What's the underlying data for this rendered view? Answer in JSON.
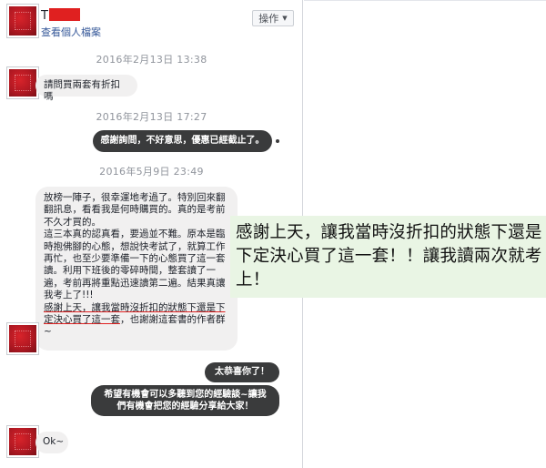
{
  "header": {
    "name": "T",
    "profile_link": "查看個人檔案",
    "action_button": "操作"
  },
  "timestamps": [
    "2016年2月13日 13:38",
    "2016年2月13日 17:27",
    "2016年5月9日 23:49"
  ],
  "messages": [
    {
      "from": "them",
      "text": "請問買兩套有折扣嗎"
    },
    {
      "from": "me",
      "text": "感謝詢問，不好意思，優惠已經截止了。"
    },
    {
      "from": "them",
      "text_main": "放榜一陣子，很幸運地考過了。特別回來翻翻訊息，看看我是何時購買的。真的是考前不久才買的。\n這三本真的認真看，要過並不難。原本是臨時抱佛腳的心態，想說快考試了，就算工作再忙，也至少要準備一下的心態買了這一套讀。利用下班後的零碎時間，整套讀了一遍，考前再將重點迅速讀第二遍。結果真讓我考上了!!!\n",
      "text_underlined": "感謝上天，讓我當時沒折扣的狀態下還是下定決心買了這一套",
      "text_end": "，也謝謝這套書的作者群~"
    },
    {
      "from": "me",
      "text": "太恭喜你了！"
    },
    {
      "from": "me",
      "text": "希望有機會可以多聽到您的經驗談~讓我們有機會把您的經驗分享給大家！"
    },
    {
      "from": "them",
      "text": "Ok~"
    }
  ],
  "callout": {
    "text": "感謝上天，讓我當時沒折扣的狀態下還是下定決心買了這一套！！讓我讀兩次就考上！",
    "background": "#e9f5e4"
  },
  "colors": {
    "outgoing_bubble": "#3a3b3c",
    "incoming_bubble": "#f1f0f0",
    "link": "#365899",
    "timestamp": "#90949c",
    "redaction": "#e02020"
  },
  "icons": [
    "caret-down-icon"
  ]
}
